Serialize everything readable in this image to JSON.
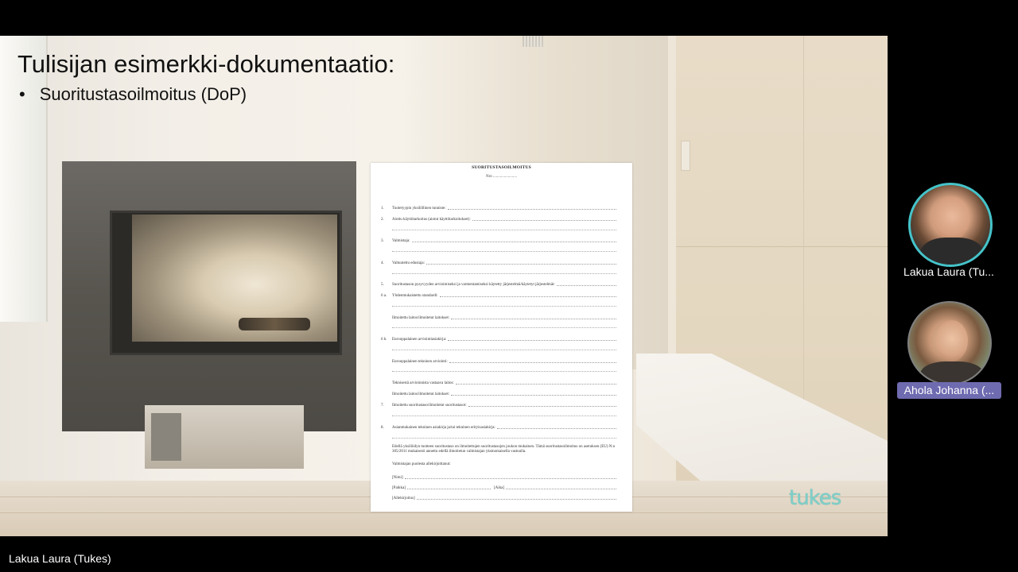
{
  "slide": {
    "title": "Tulisijan esimerkki-dokumentaatio:",
    "bullets": [
      "Suoritustasoilmoitus (DoP)"
    ],
    "logo_text": "tukes",
    "logo_color": "#7fcfc9"
  },
  "document": {
    "title": "SUORITUSTASOILMOITUS",
    "no_label": "Nro ........................",
    "rows": [
      {
        "num": "1.",
        "label": "Tuotetyypin yksilöllinen tunniste:"
      },
      {
        "num": "2.",
        "label": "Aiottu käyttötarkoitus (aiotut käyttötarkoitukset):"
      },
      {
        "num": "3.",
        "label": "Valmistaja:"
      },
      {
        "num": "4.",
        "label": "Valtuutettu edustaja:"
      },
      {
        "num": "5.",
        "label": "Suoritustason pysyvyyden arvioimiseksi ja varmentamiseksi käytetty järjestelmä/käytetyt järjestelmät:"
      },
      {
        "num": "6 a.",
        "label": "Yhdenmukaistettu standardi:"
      },
      {
        "num": "",
        "label": "Ilmoitettu laitos/ilmoitetut laitokset:"
      },
      {
        "num": "6 b.",
        "label": "Eurooppalainen arviointiasiakirja:"
      },
      {
        "num": "",
        "label": "Eurooppalainen tekninen arviointi:"
      },
      {
        "num": "",
        "label": "Teknisestä arvioinnista vastaava laitos:"
      },
      {
        "num": "",
        "label": "Ilmoitettu laitos/ilmoitetut laitokset:"
      },
      {
        "num": "7.",
        "label": "Ilmoitettu suoritustaso/ilmoitetut suoritustasot:"
      },
      {
        "num": "8.",
        "label": "Asianmukainen tekninen asiakirja ja/tai tekninen erityisasiakirja:"
      }
    ],
    "declaration": "Edellä yksilöidyn tuotteen suoritustaso on ilmoitettujen suoritustasojen joukon mukainen. Tämä suoritustasoilmoitus on asetuksen (EU) N:o 305/2011 mukaisesti annettu edellä ilmoitetun valmistajan yksinomaisella vastuulla.",
    "signed_for": "Valmistajan puolesta allekirjoittanut:",
    "name_field": "[Nimi]",
    "place_field": "[Paikka]",
    "date_field": "[Aika]",
    "signature_field": "[Allekirjoitus]"
  },
  "participants": [
    {
      "name": "Lakua Laura (Tu...",
      "ring_color": "#45c3c9",
      "speaking": true
    },
    {
      "name": "Ahola Johanna (...",
      "label_bg": "#6f6bb0",
      "speaking": false
    }
  ],
  "active_speaker_label": "Lakua Laura (Tukes)"
}
